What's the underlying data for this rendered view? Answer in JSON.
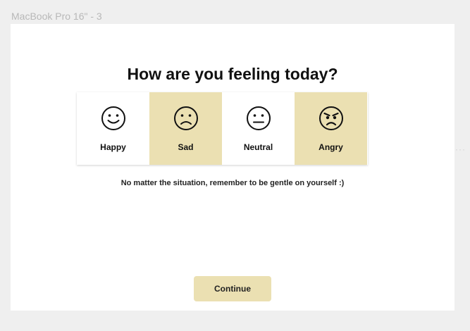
{
  "frame_label": "MacBook Pro 16\" - 3",
  "side_indicator": "···",
  "page": {
    "title": "How are you feeling today?",
    "message": "No matter the situation, remember to be gentle on yourself :)",
    "continue_label": "Continue"
  },
  "moods": [
    {
      "label": "Happy",
      "icon": "smiling-face-icon"
    },
    {
      "label": "Sad",
      "icon": "frowning-face-icon"
    },
    {
      "label": "Neutral",
      "icon": "neutral-face-icon"
    },
    {
      "label": "Angry",
      "icon": "angry-face-icon"
    }
  ],
  "colors": {
    "accent_tan": "#ebe0b2",
    "card_light": "#ffffff",
    "canvas": "#efefef"
  }
}
